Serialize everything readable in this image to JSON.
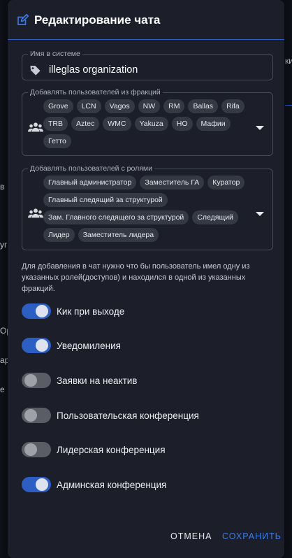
{
  "background": {
    "fragments": [
      "ки",
      "в",
      "уг",
      "Ор",
      "ар",
      "е"
    ]
  },
  "dialog": {
    "title": "Редактирование чата",
    "name_field": {
      "legend": "Имя в системе",
      "value": "illeglas organization"
    },
    "factions_field": {
      "legend": "Добавлять пользователей из фракций",
      "chips": [
        "Grove",
        "LCN",
        "Vagos",
        "NW",
        "RM",
        "Ballas",
        "Rifa",
        "TRB",
        "Aztec",
        "WMC",
        "Yakuza",
        "НО",
        "Мафии",
        "Гетто"
      ]
    },
    "roles_field": {
      "legend": "Добавлять пользователей с ролями",
      "chips": [
        "Главный администратор",
        "Заместитель ГА",
        "Куратор",
        "Главный следящий за структурой",
        "Зам. Главного следящего за структурой",
        "Следящий",
        "Лидер",
        "Заместитель лидера"
      ]
    },
    "hint": "Для добавления в чат нужно что бы пользователь имел одну из указанных ролей(доступов) и находился в одной из указанных фракций.",
    "toggles": [
      {
        "label": "Кик при выходе",
        "on": true
      },
      {
        "label": "Уведомиления",
        "on": true
      },
      {
        "label": "Заявки на неактив",
        "on": false
      },
      {
        "label": "Пользовательская конференция",
        "on": false
      },
      {
        "label": "Лидерская конференция",
        "on": false
      },
      {
        "label": "Админская конференция",
        "on": true
      }
    ],
    "buttons": {
      "cancel": "ОТМЕНА",
      "save": "СОХРАНИТЬ"
    }
  },
  "colors": {
    "accent": "#2c5ec4",
    "dialog_bg": "#1c1f2a",
    "page_bg": "#0e1118"
  }
}
